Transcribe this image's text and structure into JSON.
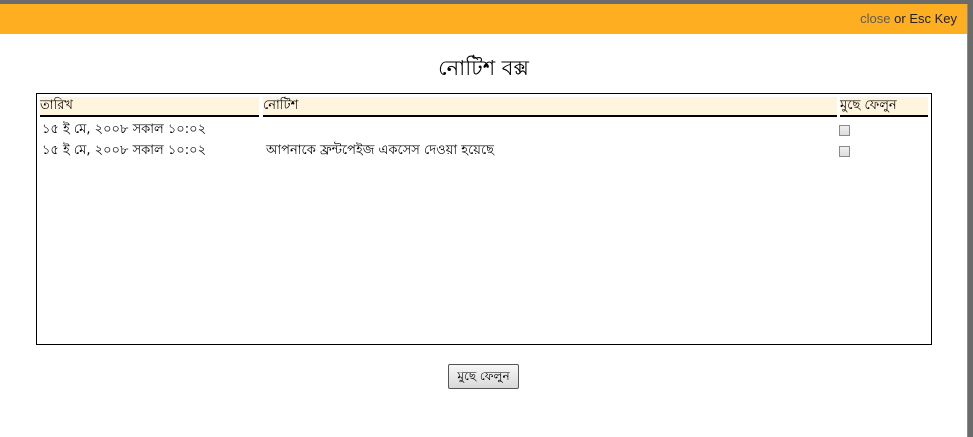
{
  "topbar": {
    "close_label": "close",
    "or_text": " or Esc Key"
  },
  "dialog": {
    "title": "নোটিশ বক্স"
  },
  "table": {
    "headers": {
      "date": "তারিখ",
      "notice": "নোটিশ",
      "delete": "মুছে ফেলুন"
    },
    "rows": [
      {
        "date": "১৫ ই মে, ২০০৮ সকাল ১০:০২",
        "notice": "",
        "checked": false
      },
      {
        "date": "১৫ ই মে, ২০০৮ সকাল ১০:০২",
        "notice": "আপনাকে ফ্রন্টপেইজ একসেস দেওয়া হয়েছে",
        "checked": false
      }
    ]
  },
  "delete_button_label": "মুছে ফেলুন",
  "colors": {
    "topbar": "#fdae21",
    "header_bg": "#fff4dd"
  }
}
